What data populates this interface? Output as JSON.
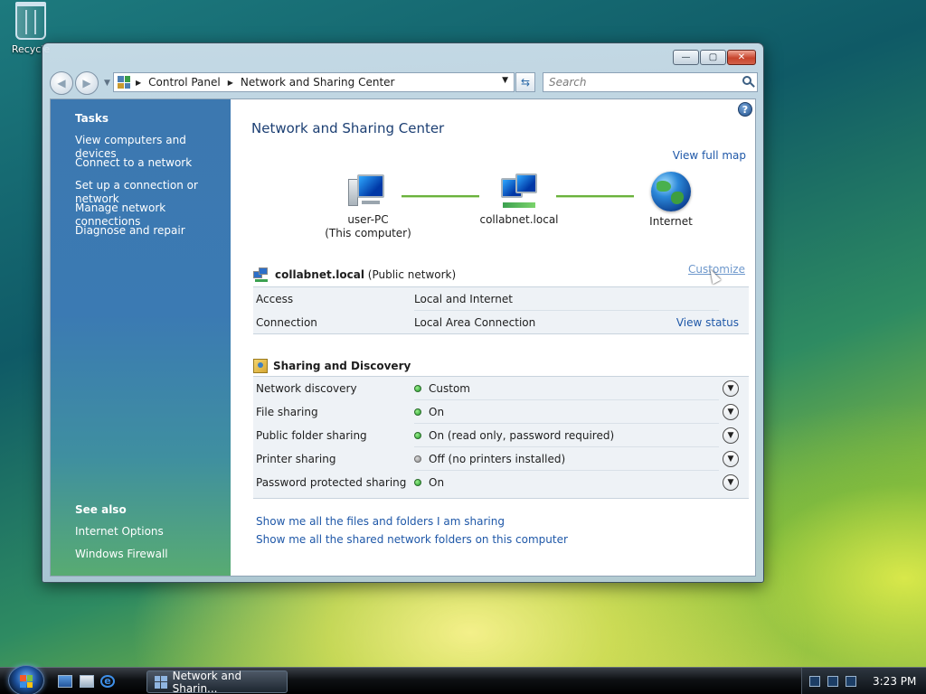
{
  "desktop": {
    "recycle_label": "Recycle"
  },
  "window": {
    "address": {
      "crumb1": "Control Panel",
      "crumb2": "Network and Sharing Center"
    },
    "search_placeholder": "Search",
    "caption": {
      "min": "—",
      "max": "▢",
      "close": "✕"
    }
  },
  "sidebar": {
    "tasks_heading": "Tasks",
    "tasks": [
      "View computers and devices",
      "Connect to a network",
      "Set up a connection or network",
      "Manage network connections",
      "Diagnose and repair"
    ],
    "see_also_heading": "See also",
    "see_also": [
      "Internet Options",
      "Windows Firewall"
    ]
  },
  "main": {
    "title": "Network and Sharing Center",
    "view_full_map": "View full map",
    "map": {
      "pc_name": "user-PC",
      "pc_sub": "(This computer)",
      "network": "collabnet.local",
      "internet": "Internet"
    },
    "network_section": {
      "name": "collabnet.local",
      "type": "(Public network)",
      "customize": "Customize",
      "rows": [
        {
          "key": "Access",
          "value": "Local and Internet",
          "action": ""
        },
        {
          "key": "Connection",
          "value": "Local Area Connection",
          "action": "View status"
        }
      ]
    },
    "sharing": {
      "heading": "Sharing and Discovery",
      "rows": [
        {
          "key": "Network discovery",
          "value": "Custom",
          "status": "on"
        },
        {
          "key": "File sharing",
          "value": "On",
          "status": "on"
        },
        {
          "key": "Public folder sharing",
          "value": "On (read only, password required)",
          "status": "on"
        },
        {
          "key": "Printer sharing",
          "value": "Off (no printers installed)",
          "status": "off"
        },
        {
          "key": "Password protected sharing",
          "value": "On",
          "status": "on"
        }
      ]
    },
    "links": [
      "Show me all the files and folders I am sharing",
      "Show me all the shared network folders on this computer"
    ]
  },
  "taskbar": {
    "task_button": "Network and Sharin...",
    "clock": "3:23 PM"
  }
}
